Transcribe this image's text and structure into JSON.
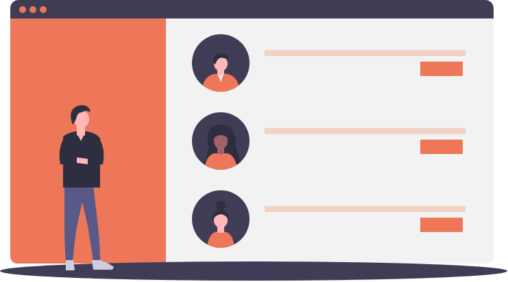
{
  "colors": {
    "accent": "#ee7659",
    "dark": "#3f3d56",
    "pale": "#f3d2c6",
    "content_bg": "#f2f2f2",
    "skin": "#ffb8b8",
    "jeans": "#575a89",
    "dot": "#ee7659"
  },
  "window": {
    "controls": [
      "close-dot",
      "minimize-dot",
      "maximize-dot"
    ]
  },
  "list": {
    "items": [
      {
        "avatar": "man-short-hair-avatar-icon",
        "hair": "short"
      },
      {
        "avatar": "woman-long-hair-avatar-icon",
        "hair": "long"
      },
      {
        "avatar": "woman-bun-hair-avatar-icon",
        "hair": "bun"
      }
    ]
  },
  "illustration": {
    "figure": "standing-man-arms-crossed-icon"
  }
}
